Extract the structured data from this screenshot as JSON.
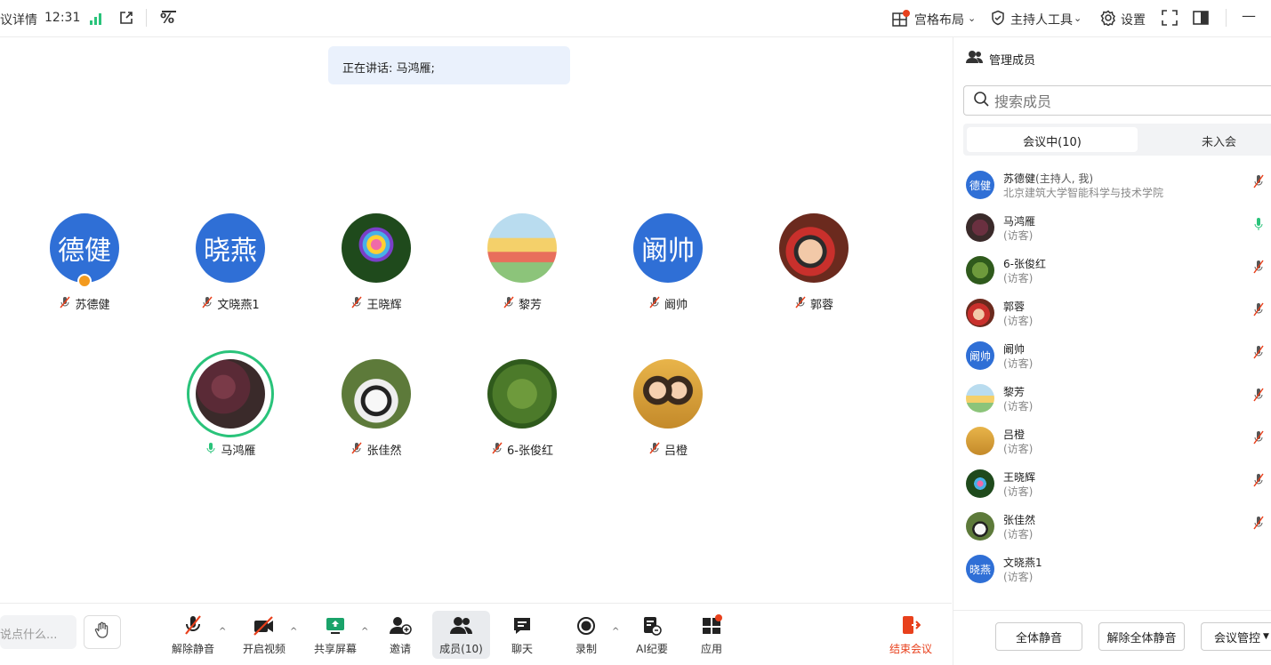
{
  "topbar": {
    "title_partial": "议详情",
    "time": "12:31",
    "grid_layout": "宫格布局",
    "host_tools": "主持人工具",
    "settings": "设置"
  },
  "speaking": {
    "label": "正在讲话: 马鸿雁;"
  },
  "tiles": [
    {
      "name": "苏德健",
      "avatar_text": "德健",
      "muted": true,
      "host": true
    },
    {
      "name": "文晓燕1",
      "avatar_text": "晓燕",
      "muted": true
    },
    {
      "name": "王晓辉",
      "muted": true
    },
    {
      "name": "黎芳",
      "muted": true
    },
    {
      "name": "阚帅",
      "avatar_text": "阚帅",
      "muted": true
    },
    {
      "name": "郭蓉",
      "muted": true
    },
    {
      "name": "马鸿雁",
      "muted": false,
      "speaking": true
    },
    {
      "name": "张佳然",
      "muted": true
    },
    {
      "name": "6-张俊红",
      "muted": true
    },
    {
      "name": "吕橙",
      "muted": true
    }
  ],
  "toolbar": {
    "input_placeholder": "说点什么...",
    "unmute": "解除静音",
    "start_video": "开启视频",
    "share_screen": "共享屏幕",
    "invite": "邀请",
    "members": "成员(10)",
    "chat": "聊天",
    "record": "录制",
    "ai_minutes": "AI纪要",
    "apps": "应用",
    "end_meeting": "结束会议"
  },
  "panel": {
    "title": "管理成员",
    "search_placeholder": "搜索成员",
    "tab_in_meeting": "会议中(10)",
    "tab_not_joined": "未入会",
    "members": [
      {
        "name": "苏德健",
        "role": "(主持人, 我)",
        "sub": "北京建筑大学智能科学与技术学院",
        "avatar_text": "德健"
      },
      {
        "name": "马鸿雁",
        "sub": "(访客)"
      },
      {
        "name": "6-张俊红",
        "sub": "(访客)"
      },
      {
        "name": "郭蓉",
        "sub": "(访客)"
      },
      {
        "name": "阚帅",
        "sub": "(访客)",
        "avatar_text": "阚帅"
      },
      {
        "name": "黎芳",
        "sub": "(访客)"
      },
      {
        "name": "吕橙",
        "sub": "(访客)"
      },
      {
        "name": "王晓辉",
        "sub": "(访客)"
      },
      {
        "name": "张佳然",
        "sub": "(访客)"
      },
      {
        "name": "文晓燕1",
        "sub": "(访客)",
        "avatar_text": "晓燕"
      }
    ],
    "mute_all": "全体静音",
    "unmute_all": "解除全体静音",
    "meeting_control": "会议管控"
  },
  "colors": {
    "accent": "#2f6fd6",
    "speaking_green": "#29c37a",
    "end_red": "#e8401c",
    "badge_orange": "#f39a1e"
  }
}
